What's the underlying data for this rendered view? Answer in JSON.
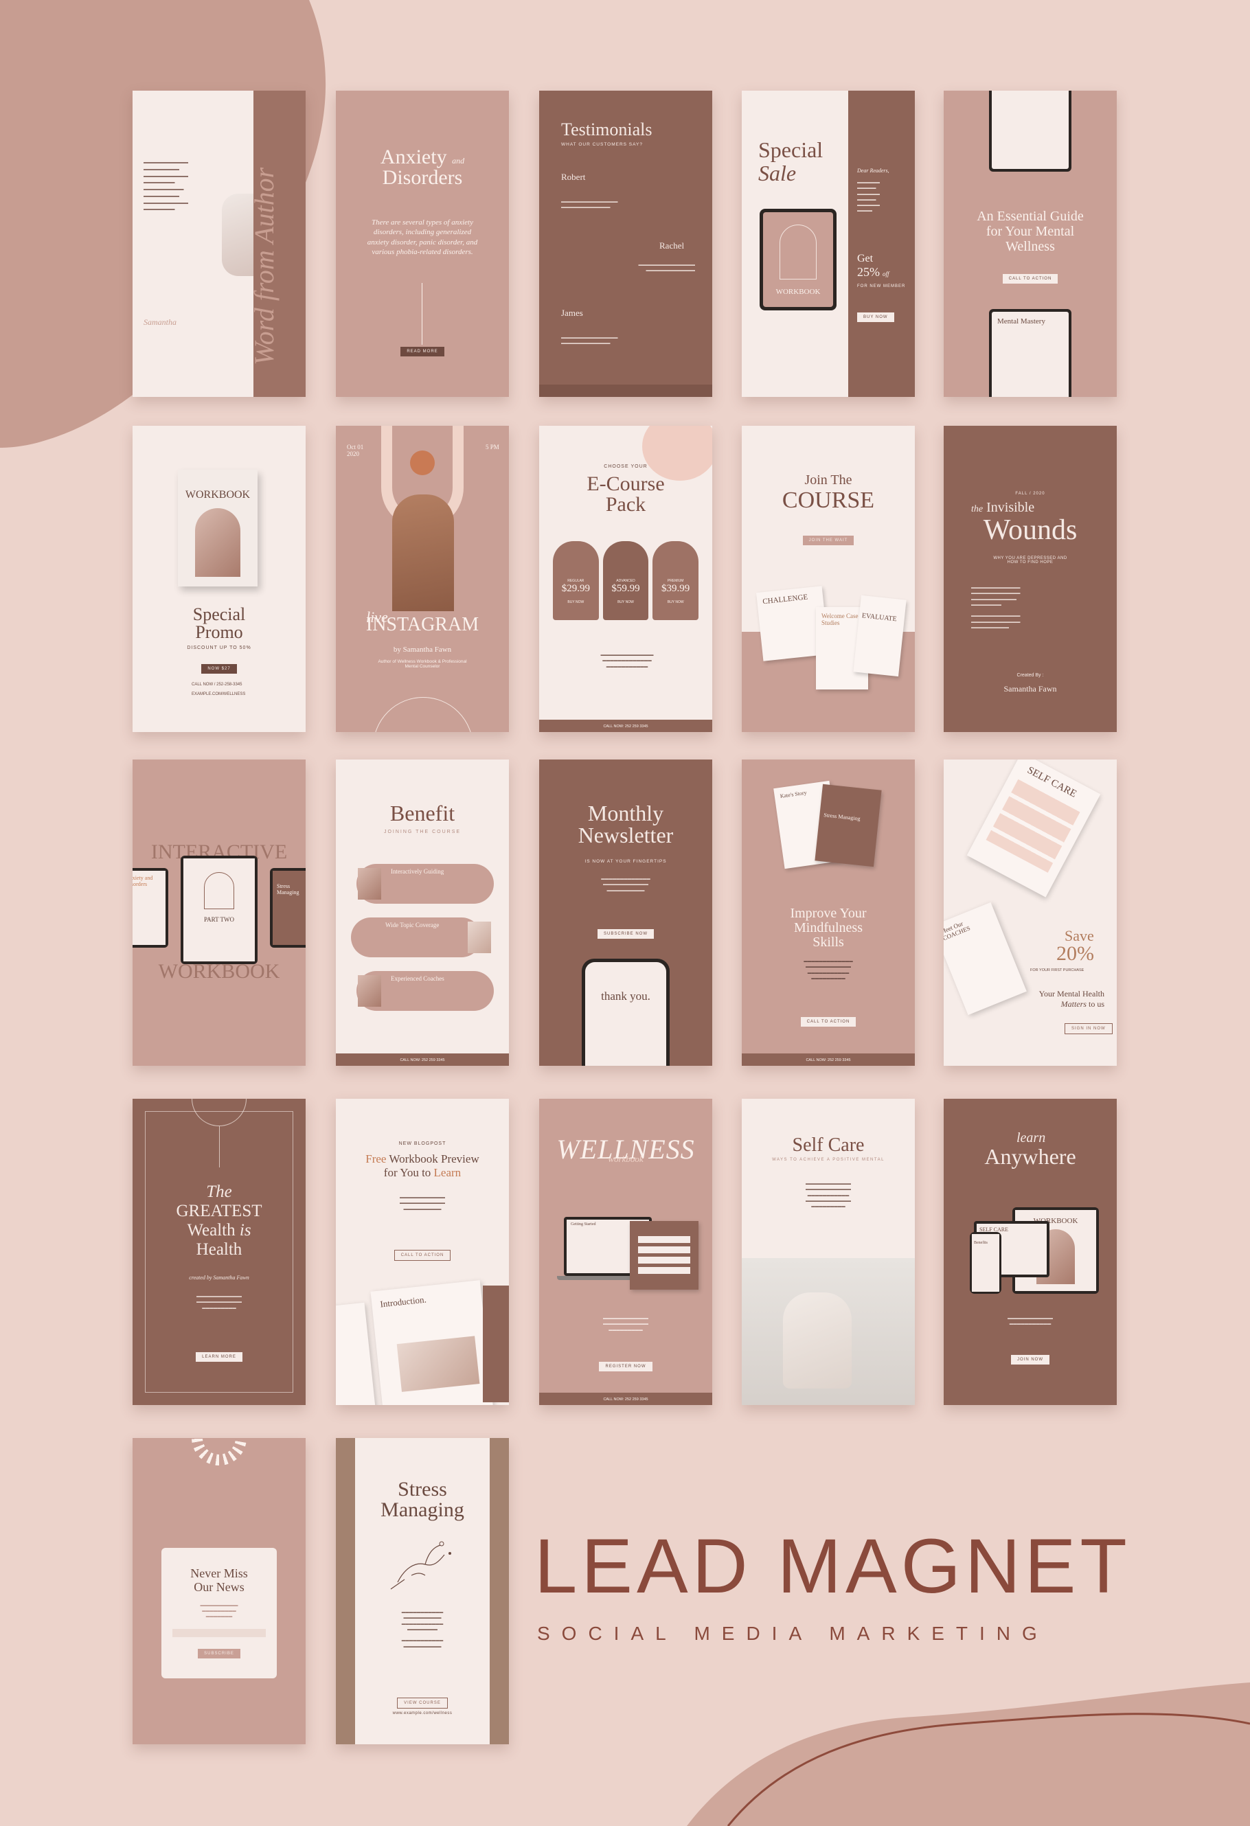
{
  "colors": {
    "dark": "#8e6457",
    "mid": "#c9a096",
    "light": "#f6ece8",
    "brand": "#8a4a3c",
    "background": "#ecd3cb"
  },
  "headline": {
    "title": "LEAD MAGNET",
    "subtitle": "SOCIAL MEDIA MARKETING"
  },
  "cards": {
    "c1": {
      "vertical": "Word from Author",
      "signature": "Samantha"
    },
    "c2": {
      "title1": "Anxiety",
      "and": "and",
      "title2": "Disorders",
      "text": "There are several types of anxiety disorders, including generalized anxiety disorder, panic disorder, and various phobia-related disorders.",
      "button": "READ MORE"
    },
    "c3": {
      "title": "Testimonials",
      "sub": "WHAT OUR CUSTOMERS SAY?",
      "n1": "Robert",
      "n2": "Rachel",
      "n3": "James"
    },
    "c4": {
      "title1": "Special",
      "title2": "Sale",
      "mock": "WORKBOOK",
      "get": "Get",
      "pct": "25%",
      "off": "off",
      "offer": "FOR NEW MEMBER",
      "button": "BUY NOW",
      "label": "Dear Readers,"
    },
    "c5": {
      "title": "An Essential Guide for Your Mental Wellness",
      "button": "CALL TO ACTION",
      "mock": "Mental Mastery"
    },
    "c6": {
      "mock": "WORKBOOK",
      "title": "Special Promo",
      "sub": "DISCOUNT UP TO 50%",
      "button": "NOW $27",
      "call": "CALL NOW / 252-258-3345",
      "web": "EXAMPLE.COM/WELLNESS"
    },
    "c7": {
      "date": "Oct 01 2020",
      "time": "5 PM",
      "live": "live",
      "title": "INSTAGRAM",
      "by": "by Samantha Fawn",
      "role": "Author of Wellness Workbook & Professional Mental Counselor"
    },
    "c8": {
      "small": "CHOOSE YOUR",
      "title": "E-Course Pack",
      "p1": "$29.99",
      "p2": "$59.99",
      "p3": "$39.99",
      "l1": "REGULAR",
      "l2": "ADVANCED",
      "l3": "PREMIUM",
      "b": "BUY NOW",
      "call": "CALL NOW: 252 259 3345"
    },
    "c9": {
      "title1": "Join The",
      "title2": "COURSE",
      "button": "JOIN THE WAIT",
      "m1": "CHALLENGE",
      "m2": "Welcome Case Studies",
      "m3": "EVALUATE"
    },
    "c10": {
      "date": "FALL / 2020",
      "the": "the",
      "title1": "Invisible",
      "title2": "Wounds",
      "sub": "WHY YOU ARE DEPRESSED AND HOW TO FIND HOPE",
      "created": "Created By :",
      "name": "Samantha Fawn"
    },
    "c11": {
      "top": "INTERACTIVE",
      "bottom": "WORKBOOK",
      "mid": "PART TWO",
      "left": "Anxiety and Disorders",
      "right": "Stress Managing"
    },
    "c12": {
      "title": "Benefit",
      "sub": "JOINING THE COURSE",
      "b1": "Interactively Guiding",
      "b2": "Wide Topic Coverage",
      "b3": "Experienced Coaches",
      "call": "CALL NOW: 252 259 3345"
    },
    "c13": {
      "title1": "Monthly",
      "title2": "Newsletter",
      "sub": "IS NOW AT YOUR FINGERTIPS",
      "button": "SUBSCRIBE NOW",
      "phone": "thank you."
    },
    "c14": {
      "title": "Improve Your Mindfulness Skills",
      "m1": "Kate's Story",
      "m2": "Stress Managing",
      "button": "CALL TO ACTION",
      "call": "CALL NOW: 252 259 3345"
    },
    "c15": {
      "tag": "SELF CARE",
      "coaches": "Meet Our COACHES",
      "save": "Save",
      "pct": "20%",
      "first": "FOR YOUR FIRST PURCHASE",
      "line1": "Your Mental Health",
      "line2": "Matters",
      "to": "to us",
      "button": "SIGN IN NOW"
    },
    "c16": {
      "the": "The",
      "l1": "GREATEST",
      "l2": "Wealth",
      "is": "is",
      "l3": "Health",
      "created": "created by Samantha Fawn",
      "button": "LEARN MORE"
    },
    "c17": {
      "small": "NEW BLOGPOST",
      "title1": "Free",
      "title2": "Workbook Preview",
      "title3": "for You to",
      "title4": "Learn",
      "button": "CALL TO ACTION",
      "m1": "Introduction."
    },
    "c18": {
      "title": "WELLNESS",
      "script": "workbook",
      "button": "REGISTER NOW",
      "call": "CALL NOW: 252 259 3345",
      "mock": "Getting Started"
    },
    "c19": {
      "title": "Self Care",
      "sub": "WAYS TO ACHIEVE A POSITIVE MENTAL"
    },
    "c20": {
      "learn": "learn",
      "title": "Anywhere",
      "m1": "WORKBOOK",
      "m2": "SELF CARE",
      "m3": "Benefits",
      "button": "JOIN NOW"
    },
    "c21": {
      "title1": "Never Miss",
      "title2": "Our News",
      "button": "SUBSCRIBE"
    },
    "c22": {
      "title1": "Stress",
      "title2": "Managing",
      "button": "VIEW COURSE",
      "web": "www.example.com/wellness"
    }
  }
}
